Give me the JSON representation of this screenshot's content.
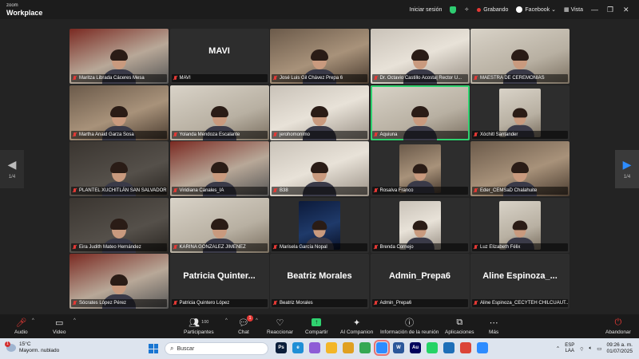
{
  "app": {
    "logo_line1": "zoom",
    "logo_line2": "Workplace"
  },
  "titlebar": {
    "signin": "Iniciar sesión",
    "recording": "Grabando",
    "facebook": "Facebook",
    "view": "Vista",
    "recording_color": "#e53935",
    "security_color": "#2ecc71"
  },
  "pager": {
    "left": "1/4",
    "right": "1/4"
  },
  "participants": [
    {
      "name": "Maritza Librada Cáceres Mesa",
      "kind": "video",
      "style": "v6"
    },
    {
      "name": "MAVI",
      "kind": "name",
      "big": "MAVI"
    },
    {
      "name": "José Luis Gil Chávez Prepa 6",
      "kind": "video",
      "style": "v3"
    },
    {
      "name": "Dr. Octavio Castillo Acosta| Rector U...",
      "kind": "video",
      "style": "v4"
    },
    {
      "name": "MAESTRA DE CEREMONIAS",
      "kind": "video",
      "style": "v2"
    },
    {
      "name": "Martha Anaid Garza Sosa",
      "kind": "video",
      "style": "v3"
    },
    {
      "name": "Yolanda Mendoza Escalante",
      "kind": "video",
      "style": "v2"
    },
    {
      "name": "jerohomonimo",
      "kind": "video",
      "style": "v4"
    },
    {
      "name": "Aquiuna",
      "kind": "video",
      "style": "v2",
      "active": true
    },
    {
      "name": "Xóchitl Santander",
      "kind": "small",
      "style": "v2"
    },
    {
      "name": "PLANTEL XUCHITLÁN SAN SALVADOR ...",
      "kind": "video",
      "style": "v5"
    },
    {
      "name": "Viridiana Canales_IA",
      "kind": "video",
      "style": "v6"
    },
    {
      "name": "B38",
      "kind": "video",
      "style": "v4"
    },
    {
      "name": "Rosalva Franco",
      "kind": "small",
      "style": "v3"
    },
    {
      "name": "Eder_CEMSaD Chalahuite",
      "kind": "video",
      "style": "v3"
    },
    {
      "name": "Eira Judith Mateo Hernández",
      "kind": "video",
      "style": "v5"
    },
    {
      "name": "KARINA GONZALEZ JIMENEZ",
      "kind": "video",
      "style": "v2"
    },
    {
      "name": "Marisela García Nopal",
      "kind": "small",
      "style": "v7"
    },
    {
      "name": "Brenda Cornejo",
      "kind": "small",
      "style": "v4"
    },
    {
      "name": "Luz Elizabeth Félix",
      "kind": "small",
      "style": "v2"
    },
    {
      "name": "Sócrates López Pérez",
      "kind": "video",
      "style": "v6"
    },
    {
      "name": "Patricia Quintero López",
      "kind": "name",
      "big": "Patricia  Quinter..."
    },
    {
      "name": "Beatriz Morales",
      "kind": "name",
      "big": "Beatriz Morales"
    },
    {
      "name": "Admin_Prepa6",
      "kind": "name",
      "big": "Admin_Prepa6"
    },
    {
      "name": "Aline Espinoza_CECYTEH CHILCUAUT...",
      "kind": "name",
      "big": "Aline  Espinoza_..."
    }
  ],
  "toolbar": {
    "audio": "Audio",
    "video": "Video",
    "participants": "Participantes",
    "participants_count": "100",
    "chat": "Chat",
    "chat_badge": "1",
    "react": "Reaccionar",
    "share": "Compartir",
    "ai": "AI Companion",
    "info": "Información de la reunión",
    "apps": "Aplicaciones",
    "more": "Más",
    "leave": "Abandonar"
  },
  "taskbar": {
    "weather_temp": "15°C",
    "weather_desc": "Mayorm. nublado",
    "weather_badge": "1",
    "search": "Buscar",
    "lang1": "ESP",
    "lang2": "LAA",
    "time": "09:26 a. m.",
    "date": "01/07/2025",
    "apps": [
      {
        "icon": "photoshop-icon",
        "label": "Ps",
        "color": "#0b1e3a"
      },
      {
        "icon": "edge-icon",
        "label": "e",
        "color": "#1f8fd6"
      },
      {
        "icon": "copilot-icon",
        "label": "",
        "color": "#8e5cd6"
      },
      {
        "icon": "folder-icon",
        "label": "",
        "color": "#f3b628"
      },
      {
        "icon": "chrome-icon",
        "label": "",
        "color": "#e0a022"
      },
      {
        "icon": "chrome2-icon",
        "label": "",
        "color": "#34a853"
      },
      {
        "icon": "zoom-taskbar-icon",
        "label": "",
        "color": "#2d8cff",
        "highlight": true
      },
      {
        "icon": "word-icon",
        "label": "W",
        "color": "#2b579a"
      },
      {
        "icon": "audition-icon",
        "label": "Au",
        "color": "#00005b"
      },
      {
        "icon": "whatsapp-icon",
        "label": "",
        "color": "#25d366"
      },
      {
        "icon": "teams-icon",
        "label": "",
        "color": "#1e6fb8"
      },
      {
        "icon": "chrome3-icon",
        "label": "",
        "color": "#db4437"
      },
      {
        "icon": "zoom2-icon",
        "label": "",
        "color": "#2d8cff"
      }
    ]
  }
}
